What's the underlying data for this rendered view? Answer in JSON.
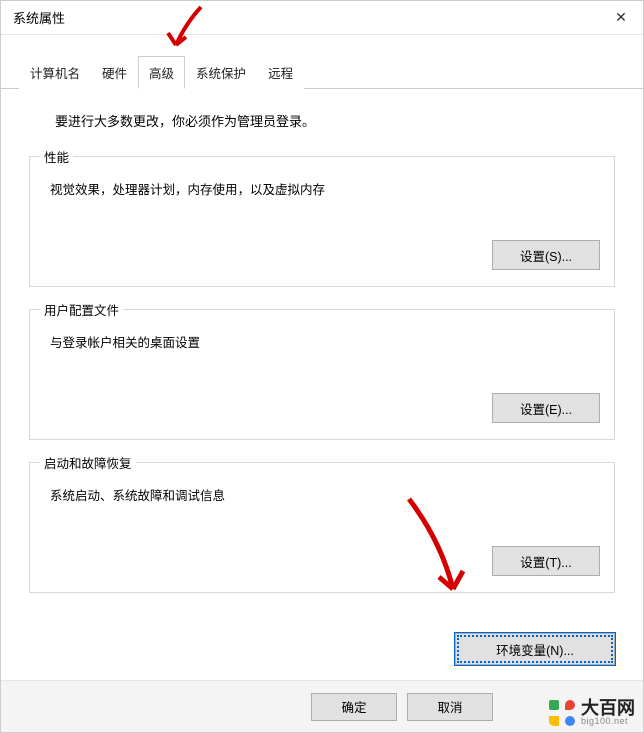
{
  "window": {
    "title": "系统属性"
  },
  "tabs": {
    "computer_name": "计算机名",
    "hardware": "硬件",
    "advanced": "高级",
    "protection": "系统保护",
    "remote": "远程"
  },
  "content": {
    "admin_note": "要进行大多数更改，你必须作为管理员登录。",
    "perf": {
      "title": "性能",
      "desc": "视觉效果，处理器计划，内存使用，以及虚拟内存",
      "button": "设置(S)..."
    },
    "profile": {
      "title": "用户配置文件",
      "desc": "与登录帐户相关的桌面设置",
      "button": "设置(E)..."
    },
    "startup": {
      "title": "启动和故障恢复",
      "desc": "系统启动、系统故障和调试信息",
      "button": "设置(T)..."
    },
    "env_button": "环境变量(N)..."
  },
  "footer": {
    "ok": "确定",
    "cancel": "取消"
  },
  "watermark": {
    "cn": "大百网",
    "en": "big100.net"
  }
}
